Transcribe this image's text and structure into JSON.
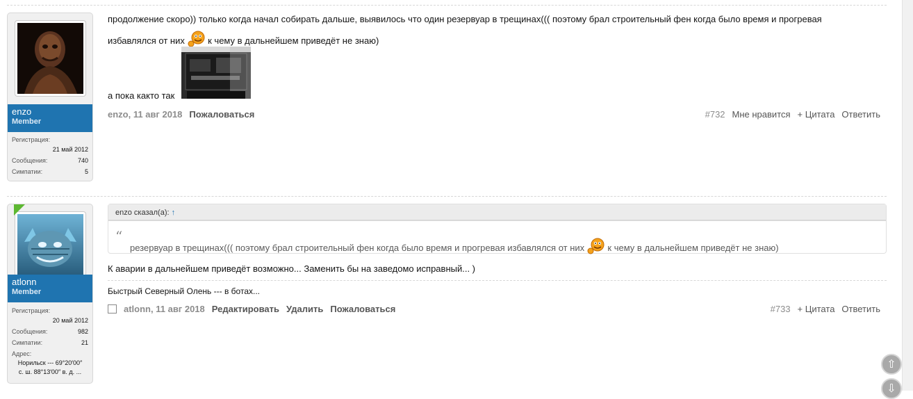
{
  "posts": [
    {
      "user": {
        "name": "enzo",
        "title": "Member",
        "stats": [
          {
            "label": "Регистрация:",
            "value": "21 май 2012"
          },
          {
            "label": "Сообщения:",
            "value": "740"
          },
          {
            "label": "Симпатии:",
            "value": "5"
          }
        ]
      },
      "text_line1": "продолжение скоро)) только когда начал собирать дальше, выявилось что один резервуар в трещинах((( поэтому брал строительный фен когда было время и прогревая",
      "text_line2_before": "избавлялся от них",
      "text_line2_after": "к чему в дальнейшем приведёт не знаю)",
      "text_line3": "а пока както так",
      "meta": {
        "author": "enzo",
        "date": "11 авг 2018",
        "report": "Пожаловаться"
      },
      "actions": {
        "number": "#732",
        "like": "Мне нравится",
        "quote": "+ Цитата",
        "reply": "Ответить"
      }
    },
    {
      "user": {
        "name": "atlonn",
        "title": "Member",
        "stats": [
          {
            "label": "Регистрация:",
            "value": "20 май 2012"
          },
          {
            "label": "Сообщения:",
            "value": "982"
          },
          {
            "label": "Симпатии:",
            "value": "21"
          }
        ],
        "address_label": "Адрес:",
        "address_line1": "Норильск --- 69°20′00″",
        "address_line2": "с. ш. 88°13′00″ в. д. ..."
      },
      "quote": {
        "author": "enzo сказал(а):",
        "arrow": "↑",
        "mark": "“",
        "text_before": "резервуар в трещинах((( поэтому брал строительный фен когда было время и прогревая избавлялся от них",
        "text_after": "к чему в дальнейшем приведёт не знаю)"
      },
      "text": "К аварии в дальнейшем приведёт возможно... Заменить бы на заведомо исправный... )",
      "signature": "Быстрый Северный Олень --- в ботах...",
      "meta": {
        "author": "atlonn",
        "date": "11 авг 2018",
        "edit": "Редактировать",
        "delete": "Удалить",
        "report": "Пожаловаться"
      },
      "actions": {
        "number": "#733",
        "quote": "+ Цитата",
        "reply": "Ответить"
      }
    }
  ],
  "scroll_up_icon": "arrow-up-icon",
  "scroll_down_icon": "arrow-down-icon",
  "colors": {
    "username_bar": "#1f74b0",
    "online": "#5db832"
  }
}
